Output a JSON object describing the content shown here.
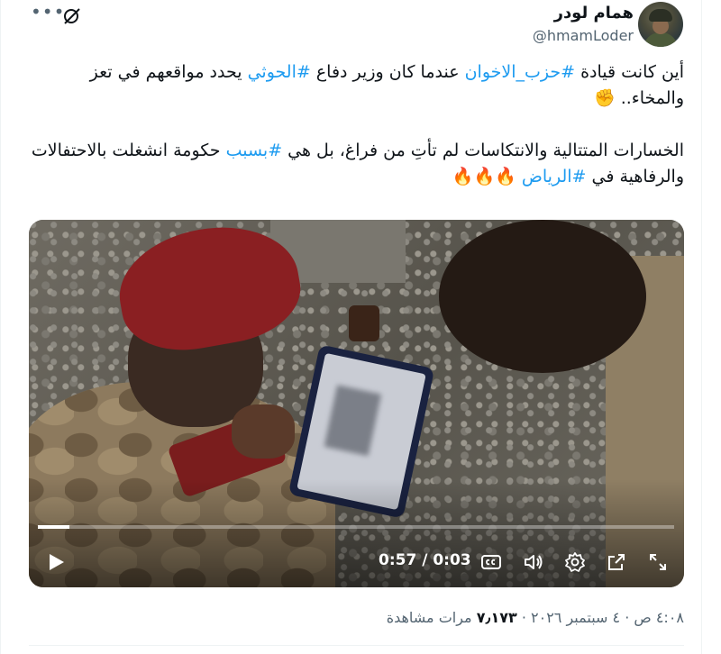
{
  "author": {
    "name": "همام لودر",
    "handle": "@hmamLoder"
  },
  "tweet": {
    "p1_pre": "أين كانت قيادة ",
    "p1_tag1": "#حزب_الاخوان",
    "p1_mid": " عندما كان وزير دفاع ",
    "p1_tag2": "#الحوثي",
    "p1_post": " يحدد مواقعهم في تعز والمخاء.. ✊",
    "p2_pre": "الخسارات المتتالية والانتكاسات لم تأتِ من فراغ، بل هي ",
    "p2_tag1": "#بسبب",
    "p2_mid": " حكومة انشغلت بالاحتفالات والرفاهية في ",
    "p2_tag2": "#الرياض",
    "p2_post": " 🔥🔥🔥"
  },
  "video": {
    "time": "0:57 / 0:03",
    "progress_fraction": 0.05
  },
  "meta": {
    "time": "٤:٠٨ ص",
    "sep": " · ",
    "date": "٤ سبتمبر ٢٠٢٦",
    "views_count": "٧٫١٧٣",
    "views_label": " مرات مشاهدة"
  },
  "icons": [
    "more-icon",
    "grok-icon",
    "play-icon",
    "captions-icon",
    "volume-icon",
    "settings-icon",
    "popout-icon",
    "fullscreen-icon"
  ]
}
